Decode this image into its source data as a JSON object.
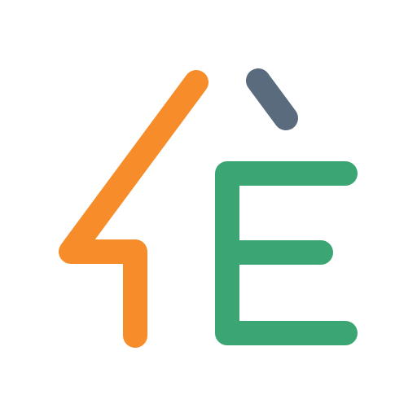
{
  "logo": {
    "text": "4È",
    "colors": {
      "background": "#ffffff",
      "four": "#f78c2a",
      "letter_e": "#3ba674",
      "accent_grave": "#5a6b7e"
    }
  }
}
